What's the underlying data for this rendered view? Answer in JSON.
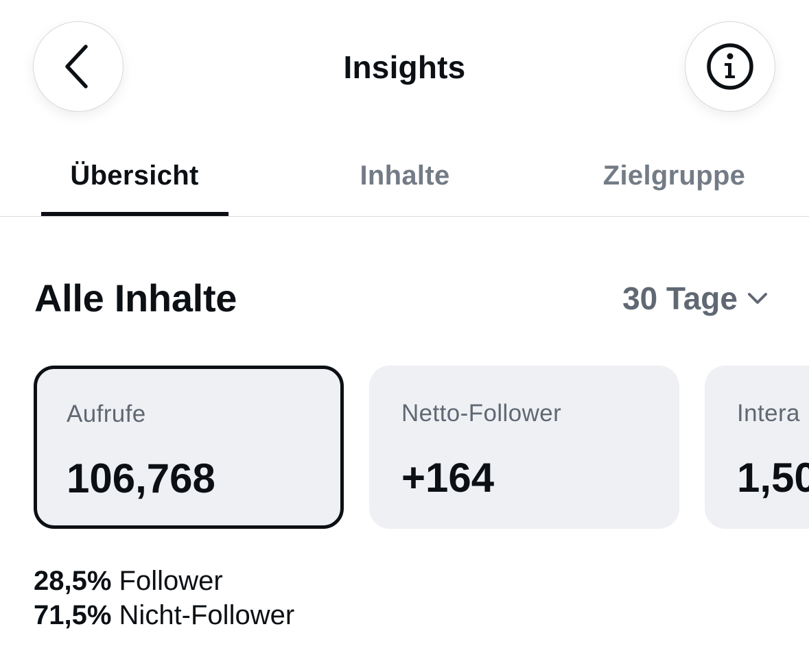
{
  "header": {
    "title": "Insights",
    "back_icon": "chevron-left-icon",
    "info_icon": "info-icon"
  },
  "tabs": [
    {
      "label": "Übersicht",
      "active": true
    },
    {
      "label": "Inhalte",
      "active": false
    },
    {
      "label": "Zielgruppe",
      "active": false
    }
  ],
  "section": {
    "title": "Alle Inhalte",
    "range_label": "30 Tage",
    "range_icon": "chevron-down-icon"
  },
  "cards": [
    {
      "label": "Aufrufe",
      "value": "106,768",
      "selected": true
    },
    {
      "label": "Netto-Follower",
      "value": "+164",
      "selected": false
    },
    {
      "label": "Intera",
      "value": "1,50",
      "selected": false
    }
  ],
  "breakdown": [
    {
      "percent": "28,5%",
      "label": "Follower"
    },
    {
      "percent": "71,5%",
      "label": "Nicht-Follower"
    }
  ],
  "colors": {
    "text_primary": "#0c1014",
    "text_secondary": "#737b86",
    "card_bg": "#eff0f4",
    "divider": "#dbdbdb"
  }
}
